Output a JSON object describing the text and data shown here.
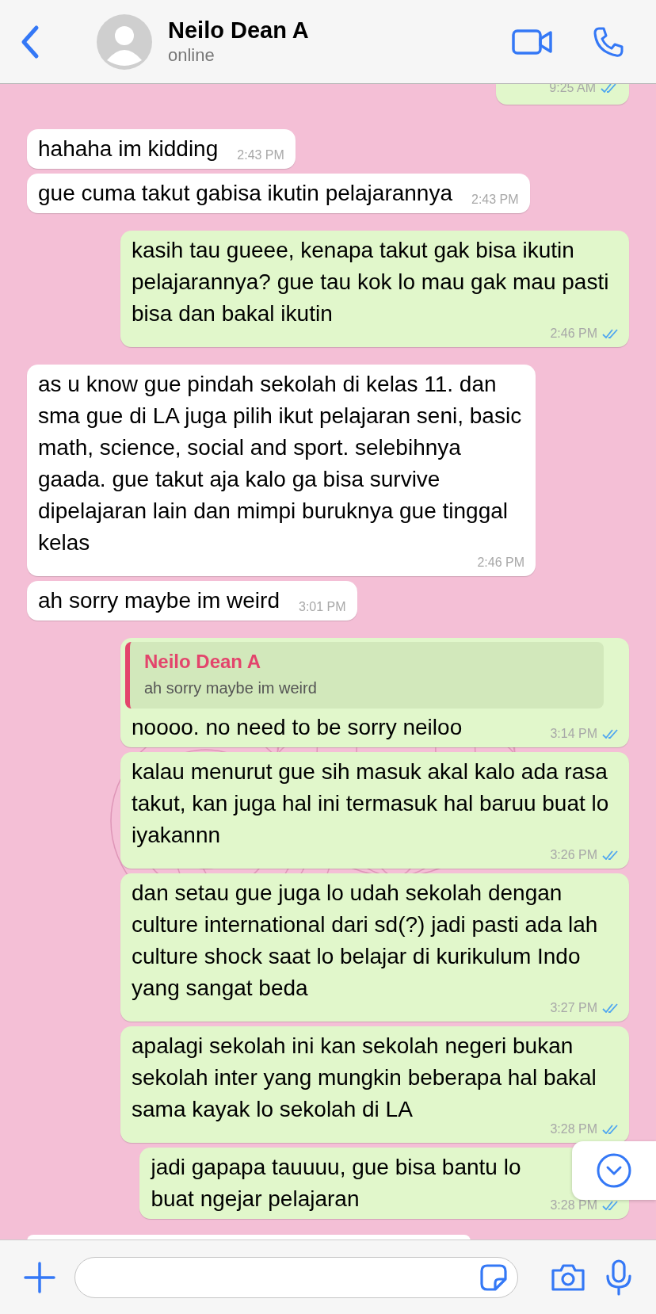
{
  "header": {
    "name": "Neilo Dean A",
    "status": "online"
  },
  "messages": [
    {
      "kind": "out",
      "time": "9:25 AM",
      "read": true
    },
    {
      "kind": "in",
      "text": "hahaha im kidding",
      "time": "2:43 PM"
    },
    {
      "kind": "in",
      "text": "gue cuma takut gabisa ikutin pelajarannya",
      "time": "2:43 PM"
    },
    {
      "kind": "out",
      "text": "kasih tau gueee, kenapa takut gak bisa ikutin pelajarannya? gue tau kok lo mau gak mau pasti bisa dan bakal ikutin",
      "time": "2:46 PM",
      "read": true
    },
    {
      "kind": "in",
      "text": "as u know gue pindah sekolah di kelas 11. dan sma gue di LA juga pilih ikut pelajaran seni, basic math, science, social and sport. selebihnya gaada. gue takut aja kalo ga bisa survive dipelajaran lain dan mimpi buruknya gue tinggal kelas",
      "time": "2:46 PM"
    },
    {
      "kind": "in",
      "text": "ah sorry maybe im weird",
      "time": "3:01 PM"
    },
    {
      "kind": "out",
      "text": "noooo. no need to be sorry neiloo",
      "time": "3:14 PM",
      "read": true,
      "quote": {
        "author": "Neilo Dean A",
        "text": "ah sorry maybe im weird"
      }
    },
    {
      "kind": "out",
      "text": "kalau menurut gue sih masuk akal kalo ada rasa takut, kan juga hal ini termasuk hal baruu buat lo iyakannn",
      "time": "3:26 PM",
      "read": true
    },
    {
      "kind": "out",
      "text": "dan setau gue juga lo udah sekolah dengan culture international dari sd(?) jadi pasti ada lah culture shock saat lo belajar di kurikulum Indo yang sangat beda",
      "time": "3:27 PM",
      "read": true
    },
    {
      "kind": "out",
      "text": "apalagi sekolah ini kan sekolah negeri bukan sekolah inter yang mungkin beberapa hal bakal sama kayak lo sekolah di LA",
      "time": "3:28 PM",
      "read": true
    },
    {
      "kind": "out",
      "text": "jadi gapapa tauuuu, gue bisa bantu lo buat ngejar pelajaran",
      "time": "3:28 PM",
      "read": true
    },
    {
      "kind": "in"
    }
  ]
}
